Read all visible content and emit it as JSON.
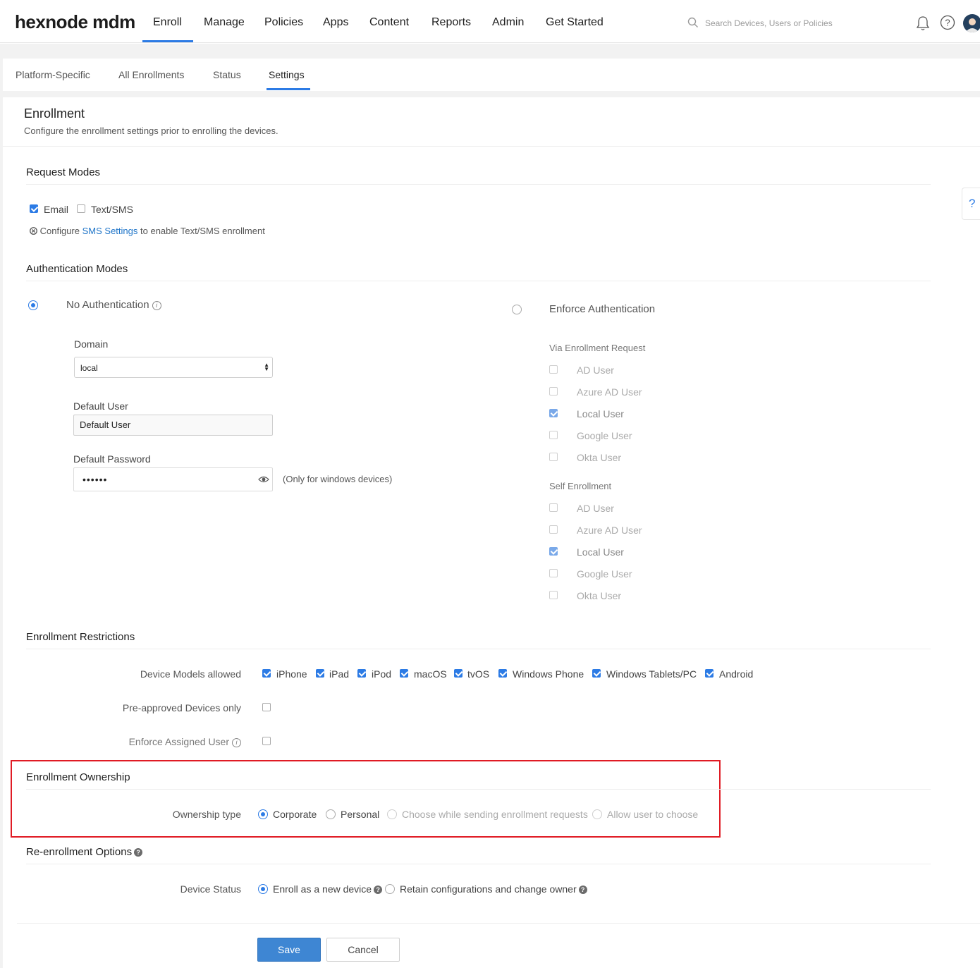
{
  "app": {
    "logo": "hexnode mdm"
  },
  "nav": {
    "items": [
      "Enroll",
      "Manage",
      "Policies",
      "Apps",
      "Content",
      "Reports",
      "Admin",
      "Get Started"
    ],
    "active": "Enroll",
    "search_placeholder": "Search Devices, Users or Policies"
  },
  "subtabs": {
    "items": [
      "Platform-Specific",
      "All Enrollments",
      "Status",
      "Settings"
    ],
    "active": "Settings"
  },
  "page": {
    "title": "Enrollment",
    "description": "Configure the enrollment settings prior to enrolling the devices."
  },
  "request_modes": {
    "title": "Request Modes",
    "email": {
      "label": "Email",
      "checked": true
    },
    "sms": {
      "label": "Text/SMS",
      "checked": false
    },
    "note_prefix": "Configure",
    "note_link": "SMS Settings",
    "note_suffix": "to enable Text/SMS enrollment"
  },
  "auth_modes": {
    "title": "Authentication Modes",
    "no_auth": {
      "label": "No Authentication",
      "selected": true,
      "domain_label": "Domain",
      "domain_value": "local",
      "default_user_label": "Default User",
      "default_user_value": "Default User",
      "default_password_label": "Default Password",
      "default_password_value": "••••••",
      "password_note": "(Only for windows devices)"
    },
    "enforce_auth": {
      "label": "Enforce Authentication",
      "selected": false,
      "via_request_title": "Via Enrollment Request",
      "via_request_items": [
        {
          "label": "AD User",
          "checked": false
        },
        {
          "label": "Azure AD User",
          "checked": false
        },
        {
          "label": "Local User",
          "checked": true
        },
        {
          "label": "Google User",
          "checked": false
        },
        {
          "label": "Okta User",
          "checked": false
        }
      ],
      "self_title": "Self Enrollment",
      "self_items": [
        {
          "label": "AD User",
          "checked": false
        },
        {
          "label": "Azure AD User",
          "checked": false
        },
        {
          "label": "Local User",
          "checked": true
        },
        {
          "label": "Google User",
          "checked": false
        },
        {
          "label": "Okta User",
          "checked": false
        }
      ]
    }
  },
  "restrictions": {
    "title": "Enrollment Restrictions",
    "models_label": "Device Models allowed",
    "models": [
      {
        "label": "iPhone",
        "checked": true
      },
      {
        "label": "iPad",
        "checked": true
      },
      {
        "label": "iPod",
        "checked": true
      },
      {
        "label": "macOS",
        "checked": true
      },
      {
        "label": "tvOS",
        "checked": true
      },
      {
        "label": "Windows Phone",
        "checked": true
      },
      {
        "label": "Windows Tablets/PC",
        "checked": true
      },
      {
        "label": "Android",
        "checked": true
      }
    ],
    "preapproved_label": "Pre-approved Devices only",
    "preapproved_checked": false,
    "assigned_label": "Enforce Assigned User",
    "assigned_checked": false
  },
  "ownership": {
    "title": "Enrollment Ownership",
    "type_label": "Ownership type",
    "options": [
      {
        "label": "Corporate",
        "selected": true
      },
      {
        "label": "Personal",
        "selected": false
      },
      {
        "label": "Choose while sending enrollment requests",
        "selected": false
      },
      {
        "label": "Allow user to choose",
        "selected": false
      }
    ]
  },
  "reenroll": {
    "title": "Re-enrollment Options",
    "status_label": "Device Status",
    "options": [
      {
        "label": "Enroll as a new device",
        "selected": true
      },
      {
        "label": "Retain configurations and change owner",
        "selected": false
      }
    ]
  },
  "actions": {
    "save": "Save",
    "cancel": "Cancel"
  },
  "side_help": "?",
  "colors": {
    "accent": "#2c7be5",
    "highlight": "#e01b24",
    "save_button": "#3e86d3"
  }
}
